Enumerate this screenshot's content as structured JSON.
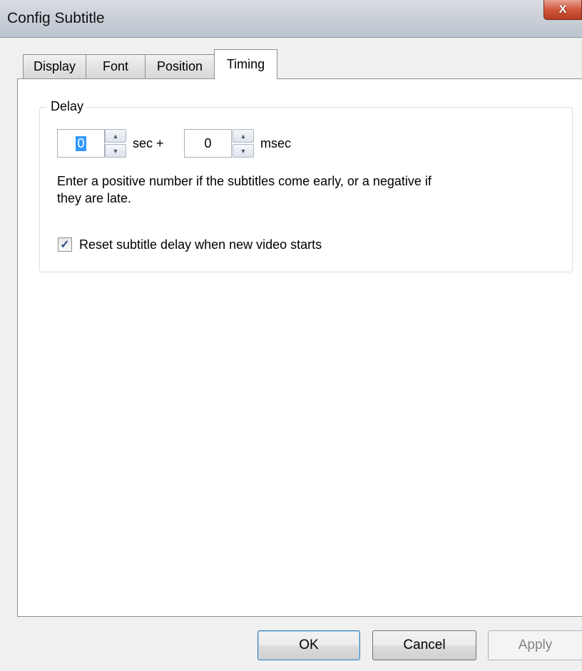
{
  "window": {
    "title": "Config Subtitle",
    "close_glyph": "X"
  },
  "tabs": [
    {
      "label": "Display",
      "active": false
    },
    {
      "label": "Font",
      "active": false
    },
    {
      "label": "Position",
      "active": false
    },
    {
      "label": "Timing",
      "active": true
    }
  ],
  "delay": {
    "group_label": "Delay",
    "sec_value": "0",
    "sec_unit": "sec +",
    "msec_value": "0",
    "msec_unit": "msec",
    "help_text_line1": "Enter a positive number if the subtitles come early, or a negative if",
    "help_text_line2": "they are late.",
    "reset_checkbox": {
      "label": "Reset subtitle delay when new video starts",
      "checked": true
    }
  },
  "buttons": {
    "ok": "OK",
    "cancel": "Cancel",
    "apply": "Apply"
  },
  "icons": {
    "spin_up": "up-arrow-icon",
    "spin_down": "down-arrow-icon",
    "check": "check-icon"
  }
}
